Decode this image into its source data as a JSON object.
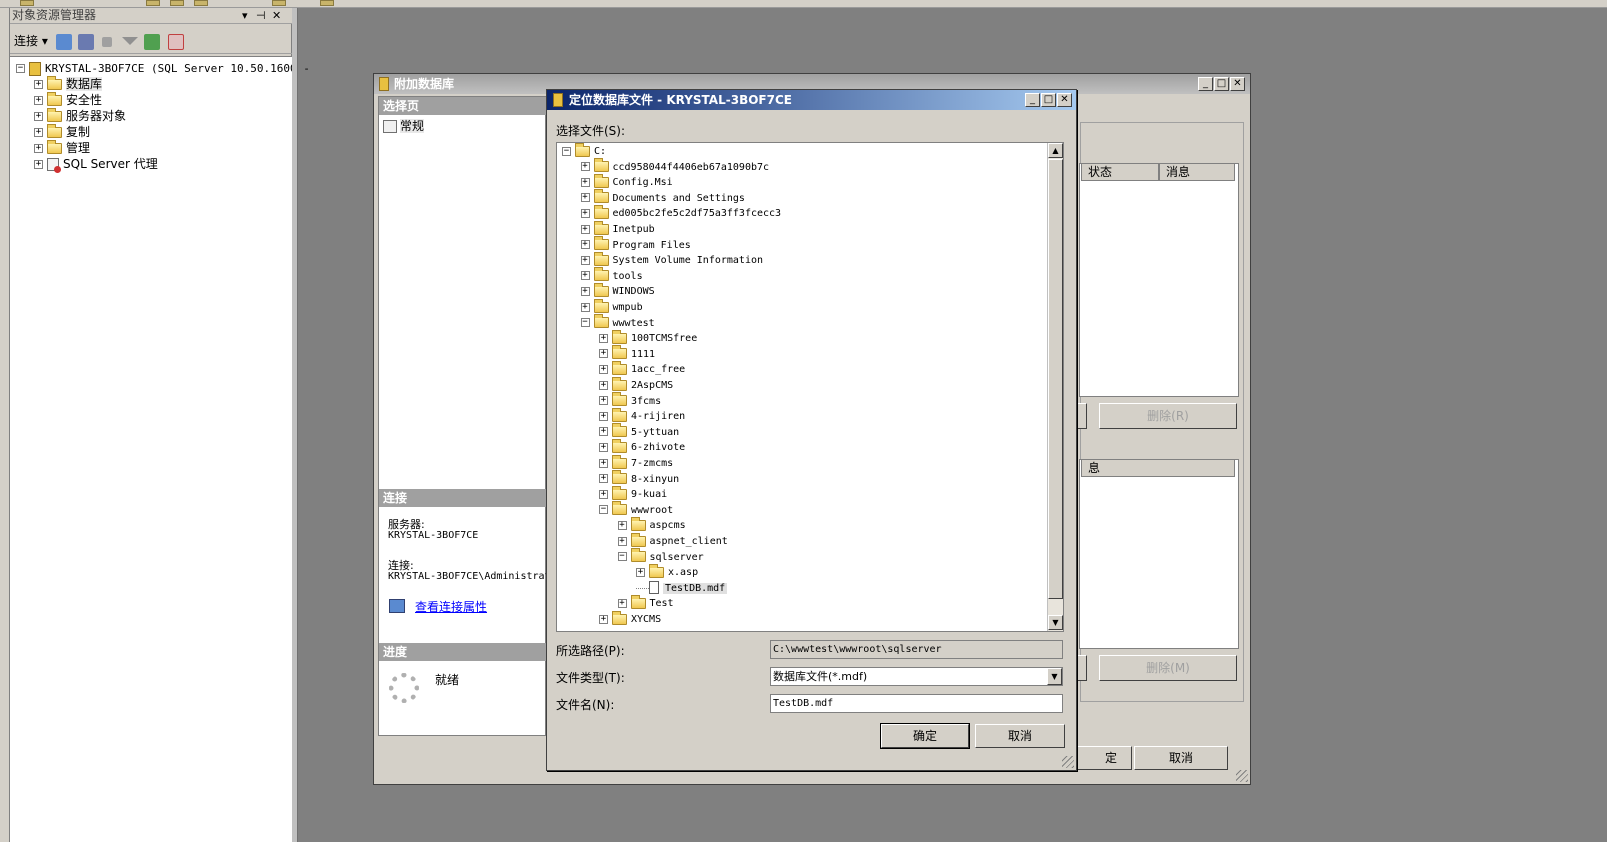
{
  "object_explorer": {
    "title": "对象资源管理器",
    "title_controls": [
      "▾",
      "⊣",
      "✕"
    ],
    "connect_label": "连接",
    "server_node": "KRYSTAL-3BOF7CE (SQL Server 10.50.1600 -",
    "nodes": [
      "数据库",
      "安全性",
      "服务器对象",
      "复制",
      "管理",
      "SQL Server 代理"
    ]
  },
  "attach_dialog": {
    "title": "附加数据库",
    "controls": [
      "_",
      "□",
      "✕"
    ],
    "select_page_header": "选择页",
    "page_general": "常规",
    "connection_header": "连接",
    "server_label": "服务器:",
    "server_value": "KRYSTAL-3BOF7CE",
    "connection_label": "连接:",
    "connection_value": "KRYSTAL-3BOF7CE\\Administrat",
    "view_connection_props": "查看连接属性",
    "progress_header": "进度",
    "progress_status": "就绪",
    "grid_col_status": "状态",
    "grid_col_message": "消息",
    "grid2_col_partial": "息",
    "remove_button_1": "删除(R)",
    "remove_button_2": "删除(M)",
    "ok_partial": "定",
    "cancel_button": "取消"
  },
  "locate_dialog": {
    "title": "定位数据库文件 - KRYSTAL-3BOF7CE",
    "controls": [
      "_",
      "□",
      "✕"
    ],
    "select_file_label": "选择文件(S):",
    "tree": [
      {
        "indent": 0,
        "expander": "−",
        "type": "folder",
        "label": "C:"
      },
      {
        "indent": 1,
        "expander": "+",
        "type": "folder",
        "label": "ccd958044f4406eb67a1090b7c"
      },
      {
        "indent": 1,
        "expander": "+",
        "type": "folder",
        "label": "Config.Msi"
      },
      {
        "indent": 1,
        "expander": "+",
        "type": "folder",
        "label": "Documents and Settings"
      },
      {
        "indent": 1,
        "expander": "+",
        "type": "folder",
        "label": "ed005bc2fe5c2df75a3ff3fcecc3"
      },
      {
        "indent": 1,
        "expander": "+",
        "type": "folder",
        "label": "Inetpub"
      },
      {
        "indent": 1,
        "expander": "+",
        "type": "folder",
        "label": "Program Files"
      },
      {
        "indent": 1,
        "expander": "+",
        "type": "folder",
        "label": "System Volume Information"
      },
      {
        "indent": 1,
        "expander": "+",
        "type": "folder",
        "label": "tools"
      },
      {
        "indent": 1,
        "expander": "+",
        "type": "folder",
        "label": "WINDOWS"
      },
      {
        "indent": 1,
        "expander": "+",
        "type": "folder",
        "label": "wmpub"
      },
      {
        "indent": 1,
        "expander": "−",
        "type": "folder",
        "label": "wwwtest"
      },
      {
        "indent": 2,
        "expander": "+",
        "type": "folder",
        "label": "100TCMSfree"
      },
      {
        "indent": 2,
        "expander": "+",
        "type": "folder",
        "label": "1111"
      },
      {
        "indent": 2,
        "expander": "+",
        "type": "folder",
        "label": "1acc_free"
      },
      {
        "indent": 2,
        "expander": "+",
        "type": "folder",
        "label": "2AspCMS"
      },
      {
        "indent": 2,
        "expander": "+",
        "type": "folder",
        "label": "3fcms"
      },
      {
        "indent": 2,
        "expander": "+",
        "type": "folder",
        "label": "4-rijiren"
      },
      {
        "indent": 2,
        "expander": "+",
        "type": "folder",
        "label": "5-yttuan"
      },
      {
        "indent": 2,
        "expander": "+",
        "type": "folder",
        "label": "6-zhivote"
      },
      {
        "indent": 2,
        "expander": "+",
        "type": "folder",
        "label": "7-zmcms"
      },
      {
        "indent": 2,
        "expander": "+",
        "type": "folder",
        "label": "8-xinyun"
      },
      {
        "indent": 2,
        "expander": "+",
        "type": "folder",
        "label": "9-kuai"
      },
      {
        "indent": 2,
        "expander": "−",
        "type": "folder",
        "label": "wwwroot"
      },
      {
        "indent": 3,
        "expander": "+",
        "type": "folder",
        "label": "aspcms"
      },
      {
        "indent": 3,
        "expander": "+",
        "type": "folder",
        "label": "aspnet_client"
      },
      {
        "indent": 3,
        "expander": "−",
        "type": "folder",
        "label": "sqlserver"
      },
      {
        "indent": 4,
        "expander": "+",
        "type": "folder",
        "label": "x.asp"
      },
      {
        "indent": 4,
        "expander": "",
        "type": "file",
        "label": "TestDB.mdf",
        "selected": true
      },
      {
        "indent": 3,
        "expander": "+",
        "type": "folder",
        "label": "Test"
      },
      {
        "indent": 2,
        "expander": "+",
        "type": "folder",
        "label": "XYCMS"
      }
    ],
    "path_label": "所选路径(P):",
    "path_value": "C:\\wwwtest\\wwwroot\\sqlserver",
    "file_type_label": "文件类型(T):",
    "file_type_value": "数据库文件(*.mdf)",
    "file_name_label": "文件名(N):",
    "file_name_value": "TestDB.mdf",
    "ok_button": "确定",
    "cancel_button": "取消"
  },
  "colors": {
    "title_active": "#0a246a",
    "title_inactive": "#a0a0a0",
    "dialog_face": "#d4d0c8",
    "link": "#0000ff"
  }
}
